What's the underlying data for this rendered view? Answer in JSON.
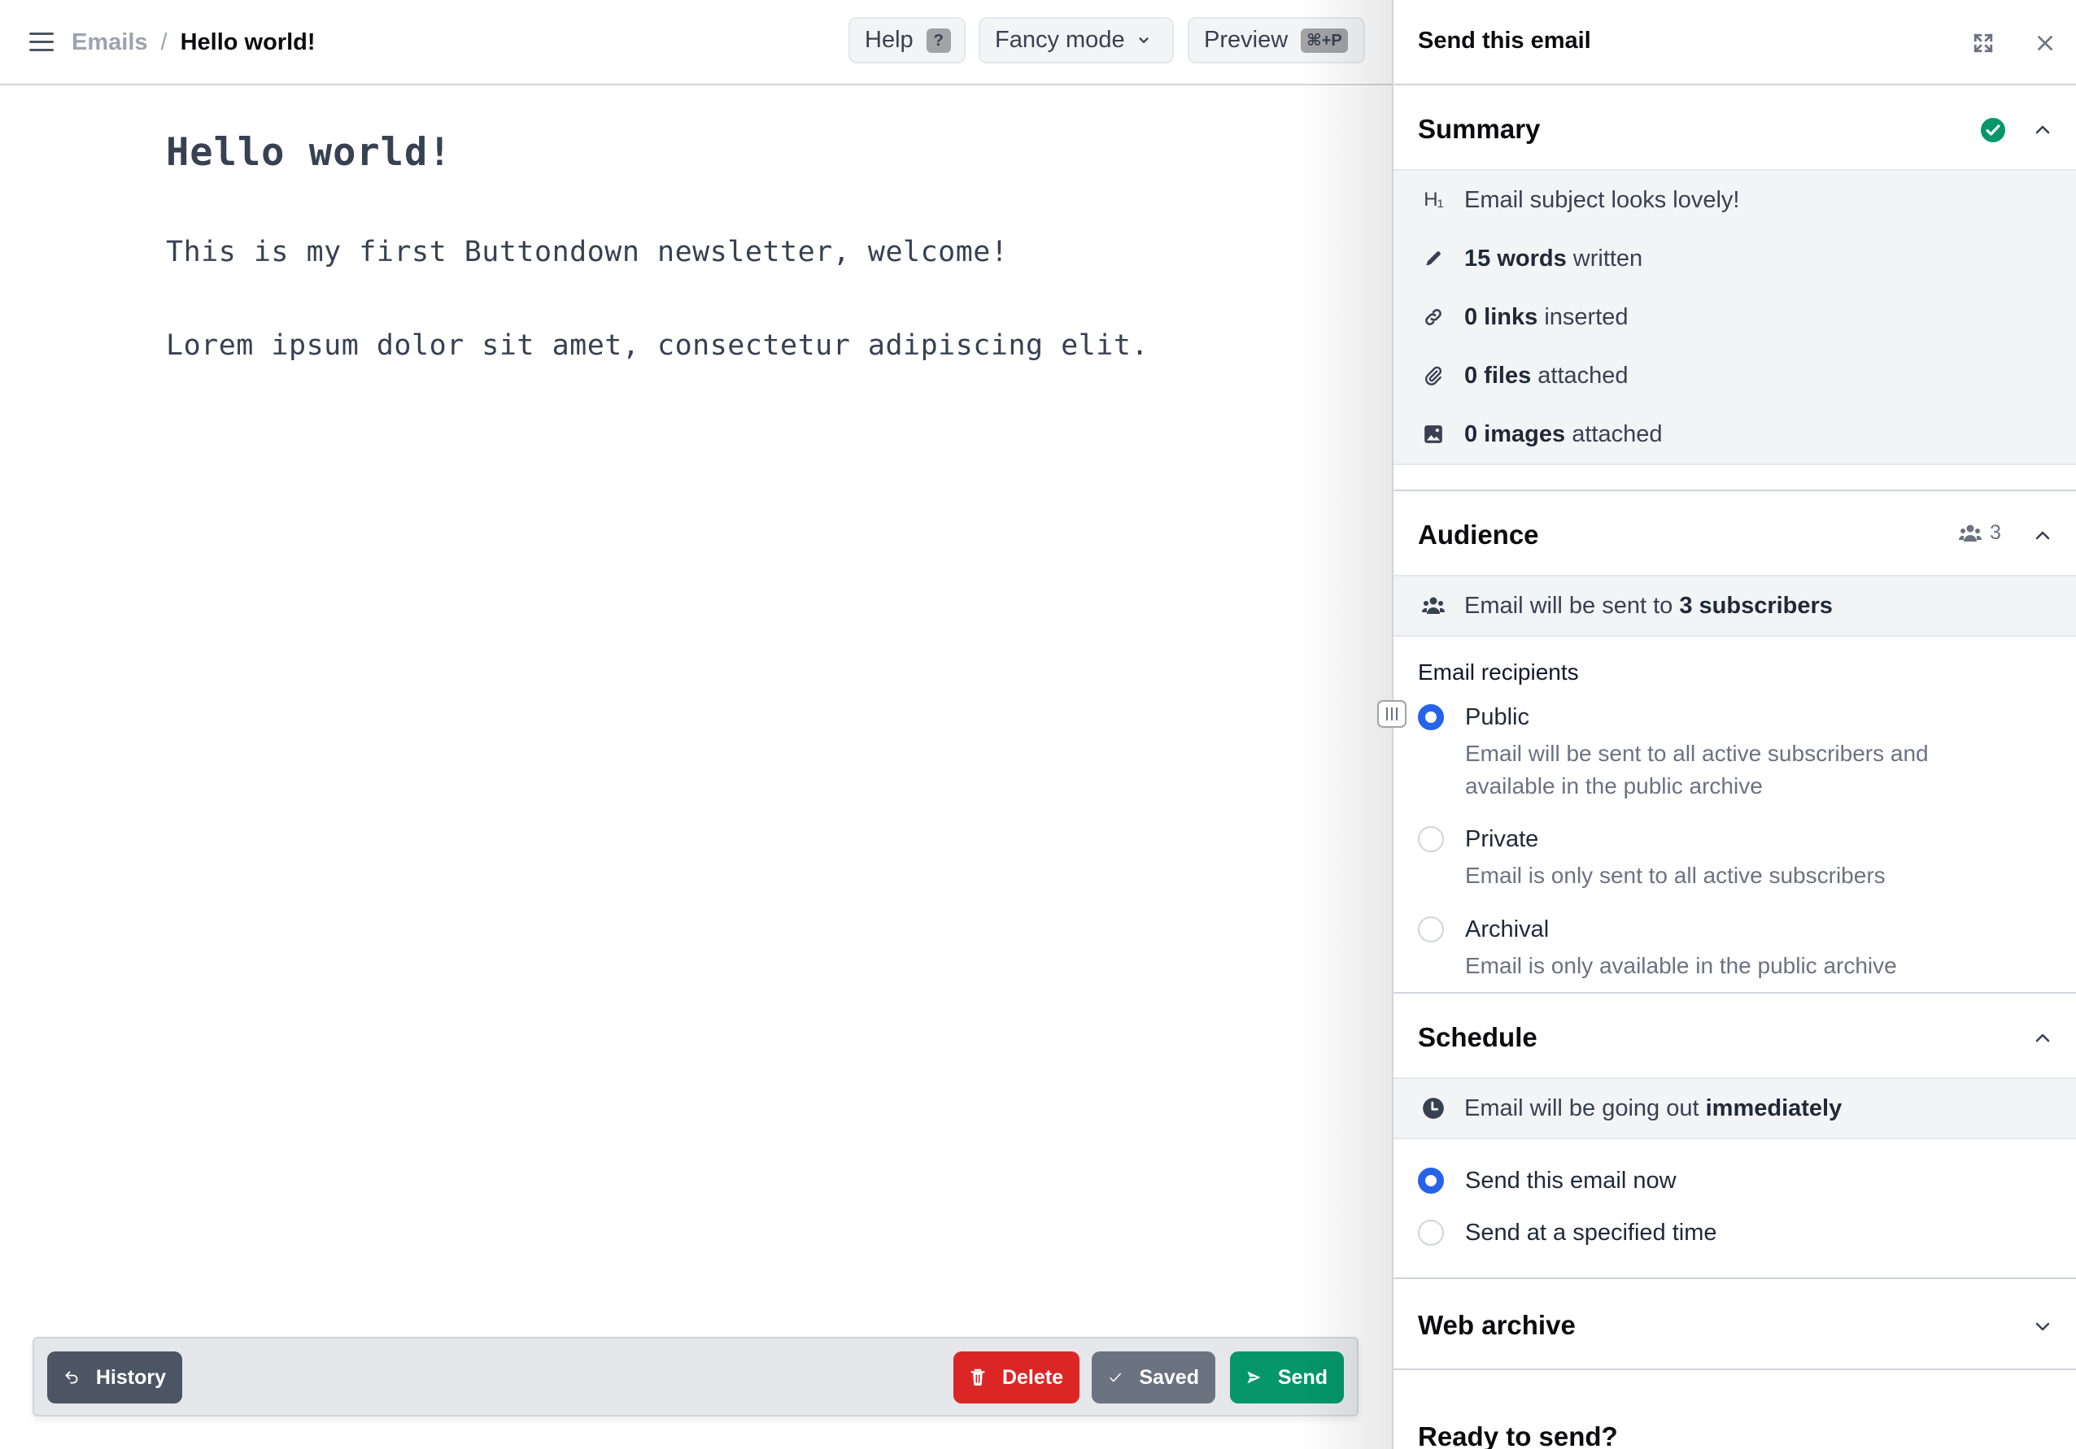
{
  "header": {
    "breadcrumb": {
      "parent": "Emails",
      "separator": "/",
      "current": "Hello world!"
    },
    "buttons": {
      "help": {
        "label": "Help",
        "shortcut": "?"
      },
      "fancy_mode": {
        "label": "Fancy mode"
      },
      "preview": {
        "label": "Preview",
        "shortcut": "⌘+P"
      }
    }
  },
  "editor": {
    "title": "Hello world!",
    "paragraphs": [
      "This is my first Buttondown newsletter, welcome!",
      "Lorem ipsum dolor sit amet, consectetur adipiscing elit."
    ]
  },
  "bottom_bar": {
    "history": "History",
    "delete": "Delete",
    "saved": "Saved",
    "send": "Send"
  },
  "panel": {
    "title": "Send this email",
    "summary": {
      "title": "Summary",
      "status": "ok",
      "items": [
        {
          "icon": "heading-icon",
          "bold": "",
          "text": "Email subject looks lovely!"
        },
        {
          "icon": "pencil-icon",
          "bold": "15 words",
          "text": " written"
        },
        {
          "icon": "link-icon",
          "bold": "0 links",
          "text": " inserted"
        },
        {
          "icon": "paperclip-icon",
          "bold": "0 files",
          "text": " attached"
        },
        {
          "icon": "image-icon",
          "bold": "0 images",
          "text": " attached"
        }
      ]
    },
    "audience": {
      "title": "Audience",
      "count": "3",
      "info_prefix": "Email will be sent to ",
      "info_bold": "3 subscribers",
      "recipients_label": "Email recipients",
      "options": [
        {
          "label": "Public",
          "description": "Email will be sent to all active subscribers and available in the public archive",
          "checked": true
        },
        {
          "label": "Private",
          "description": "Email is only sent to all active subscribers",
          "checked": false
        },
        {
          "label": "Archival",
          "description": "Email is only available in the public archive",
          "checked": false
        }
      ]
    },
    "schedule": {
      "title": "Schedule",
      "info_prefix": "Email will be going out ",
      "info_bold": "immediately",
      "options": [
        {
          "label": "Send this email now",
          "checked": true
        },
        {
          "label": "Send at a specified time",
          "checked": false
        }
      ]
    },
    "web_archive": {
      "title": "Web archive"
    },
    "ready": {
      "title": "Ready to send?"
    }
  },
  "colors": {
    "accent_blue": "#2563eb",
    "success_green": "#059669",
    "danger_red": "#dc2626",
    "neutral_gray": "#6b7280",
    "dark_slate": "#4b5563"
  }
}
